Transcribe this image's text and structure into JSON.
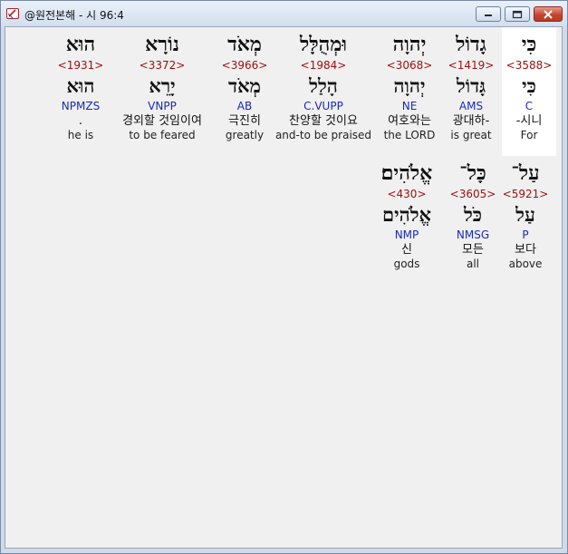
{
  "window": {
    "title": "@원전본해 - 시 96:4"
  },
  "verse_lines": [
    {
      "words": [
        {
          "hebrew": "כִּי",
          "strong": "<3588>",
          "root": "כִּי",
          "morph": "C",
          "korean": "-시니",
          "english": "For"
        },
        {
          "hebrew": "גָדוֹל",
          "strong": "<1419>",
          "root": "גָּדוֹל",
          "morph": "AMS",
          "korean": "광대하-",
          "english": "is great"
        },
        {
          "hebrew": "יְהוָה",
          "strong": "<3068>",
          "root": "יְהוָה",
          "morph": "NE",
          "korean": "여호와는",
          "english": "the LORD"
        },
        {
          "hebrew": "וּמְהֻלָּל",
          "strong": "<1984>",
          "root": "הָלַל",
          "morph": "C.VUPP",
          "korean": "찬양할 것이요",
          "english": "and-to be praised"
        },
        {
          "hebrew": "מְאֹד",
          "strong": "<3966>",
          "root": "מְאֹד",
          "morph": "AB",
          "korean": "극진히",
          "english": "greatly"
        },
        {
          "hebrew": "נוֹרָא",
          "strong": "<3372>",
          "root": "יָרֵא",
          "morph": "VNPP",
          "korean": "경외할 것임이여",
          "english": "to be feared"
        },
        {
          "hebrew": "הוּא",
          "strong": "<1931>",
          "root": "הוּא",
          "morph": "NPMZS",
          "korean": ".",
          "english": "he is"
        }
      ]
    },
    {
      "words": [
        {
          "hebrew": "עַל־",
          "strong": "<5921>",
          "root": "עַל",
          "morph": "P",
          "korean": "보다",
          "english": "above"
        },
        {
          "hebrew": "כָּל־",
          "strong": "<3605>",
          "root": "כֹּל",
          "morph": "NMSG",
          "korean": "모든",
          "english": "all"
        },
        {
          "hebrew": "אֱלֹהִים׃",
          "strong": "<430>",
          "root": "אֱלֹהִים",
          "morph": "NMP",
          "korean": "신",
          "english": "gods"
        }
      ]
    }
  ]
}
